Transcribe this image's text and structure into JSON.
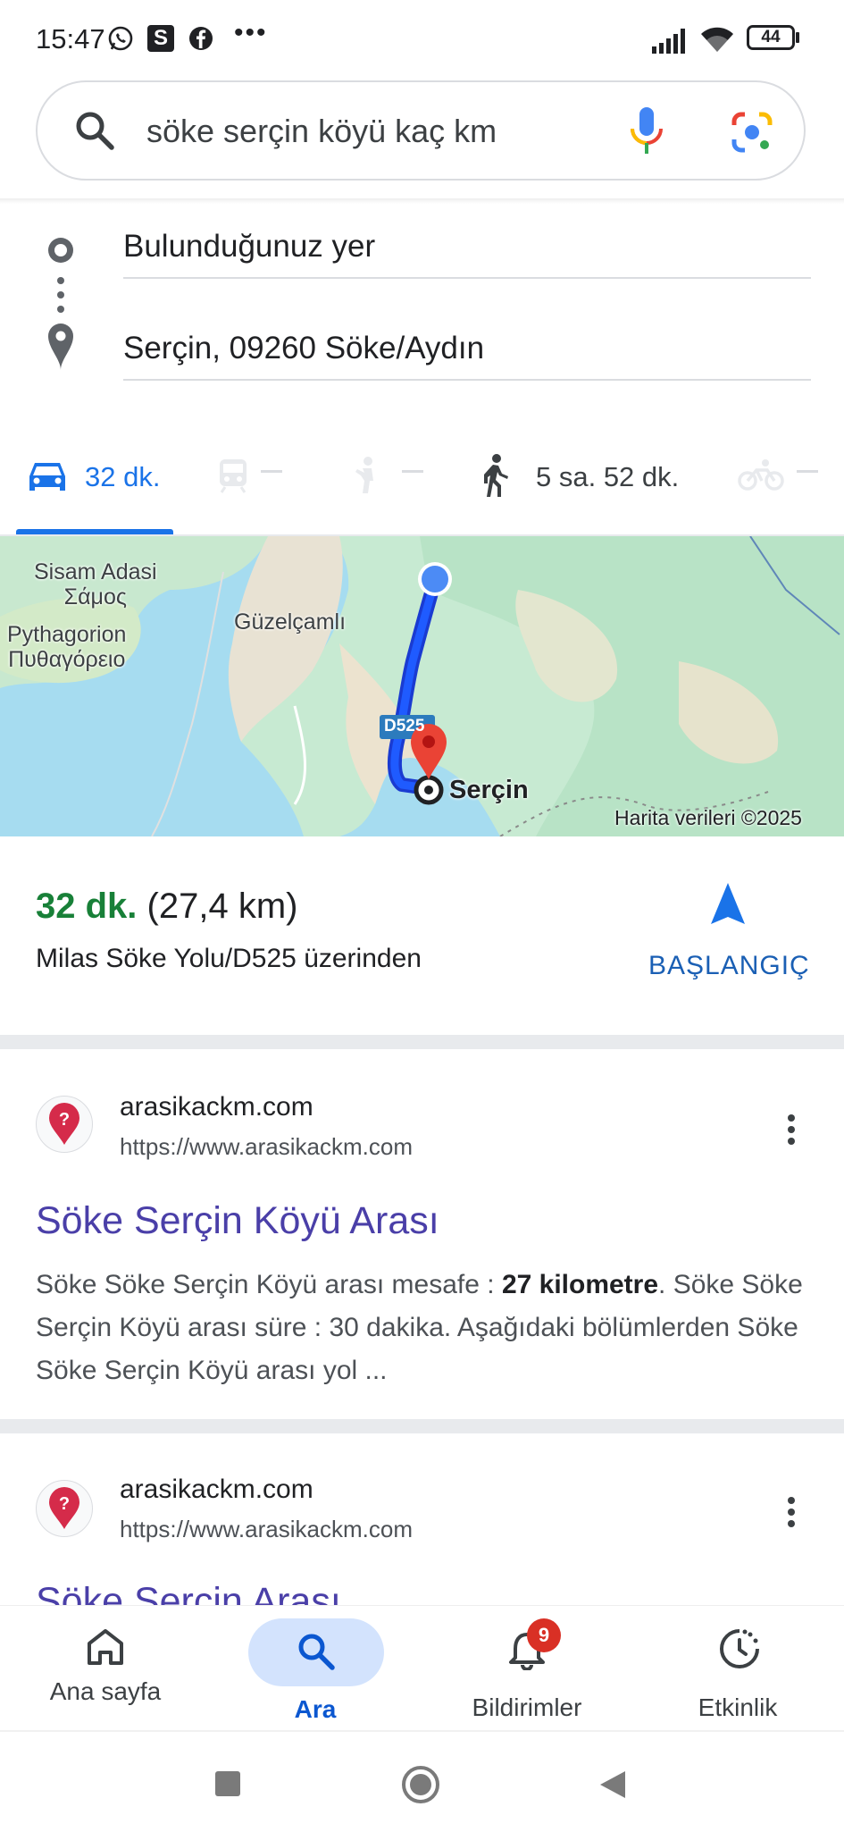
{
  "status_bar": {
    "time": "15:47",
    "battery": "44"
  },
  "search": {
    "query": "söke serçin köyü kaç km"
  },
  "directions": {
    "origin": "Bulunduğunuz yer",
    "destination": "Serçin, 09260 Söke/Aydın",
    "modes": [
      {
        "name": "car",
        "value": "32 dk.",
        "selected": true
      },
      {
        "name": "transit",
        "value": "—"
      },
      {
        "name": "taxi",
        "value": "—"
      },
      {
        "name": "walk",
        "value": "5 sa. 52 dk."
      },
      {
        "name": "bike",
        "value": "—"
      }
    ]
  },
  "map": {
    "labels": {
      "sisam": "Sisam Adasi",
      "samos": "Σάμος",
      "pythagorion": "Pythagorion",
      "pythagorion_gr": "Πυθαγόρειο",
      "guzelcamli": "Güzelçamlı",
      "road": "D525",
      "destination": "Serçin",
      "attribution": "Harita verileri ©2025"
    }
  },
  "route_summary": {
    "time": "32 dk.",
    "distance": "(27,4 km)",
    "via": "Milas Söke Yolu/D525 üzerinden",
    "start_label": "BAŞLANGIÇ"
  },
  "results": [
    {
      "site": "arasikackm.com",
      "url": "https://www.arasikackm.com",
      "title": "Söke Serçin Köyü Arası",
      "snippet_1": "Söke Söke Serçin Köyü arası mesafe : ",
      "snippet_bold": "27 kilometre",
      "snippet_2": ". Söke Söke Serçin Köyü arası süre : 30 dakika. Aşağıdaki bölümlerden Söke Söke Serçin Köyü arası yol ..."
    },
    {
      "site": "arasikackm.com",
      "url": "https://www.arasikackm.com",
      "title": "Söke Serçin Arası"
    }
  ],
  "bottom_nav": {
    "items": [
      {
        "label": "Ana sayfa",
        "icon": "home-icon"
      },
      {
        "label": "Ara",
        "icon": "search-icon",
        "active": true
      },
      {
        "label": "Bildirimler",
        "icon": "bell-icon",
        "badge": "9"
      },
      {
        "label": "Etkinlik",
        "icon": "activity-icon"
      }
    ]
  },
  "colors": {
    "accent": "#1a73e8",
    "green_time": "#188038",
    "badge": "#d93025",
    "link": "#4a3fa8"
  }
}
